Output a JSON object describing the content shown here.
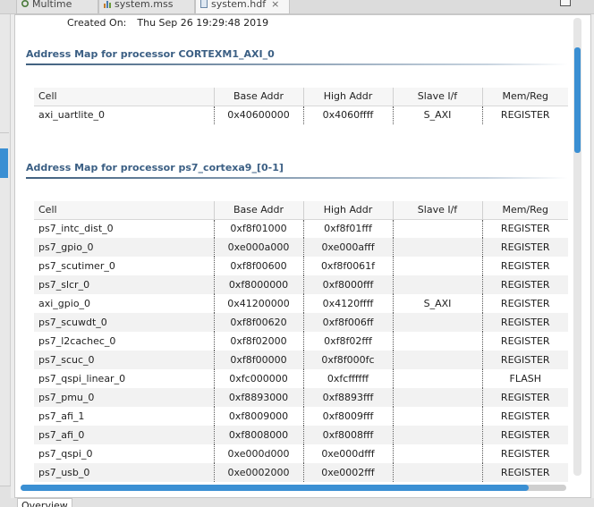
{
  "tabs": [
    {
      "label": "Multime",
      "icon": "gear-icon"
    },
    {
      "label": "system.mss",
      "icon": "chart-icon"
    },
    {
      "label": "system.hdf",
      "icon": "document-icon",
      "close": "×"
    }
  ],
  "created": {
    "label": "Created On:",
    "value": "Thu Sep 26 19:29:48 2019"
  },
  "columns": [
    "Cell",
    "Base Addr",
    "High Addr",
    "Slave I/f",
    "Mem/Reg"
  ],
  "sections": [
    {
      "title": "Address Map for processor CORTEXM1_AXI_0",
      "rows": [
        [
          "axi_uartlite_0",
          "0x40600000",
          "0x4060ffff",
          "S_AXI",
          "REGISTER"
        ]
      ]
    },
    {
      "title": "Address Map for processor ps7_cortexa9_[0-1]",
      "rows": [
        [
          "ps7_intc_dist_0",
          "0xf8f01000",
          "0xf8f01fff",
          "",
          "REGISTER"
        ],
        [
          "ps7_gpio_0",
          "0xe000a000",
          "0xe000afff",
          "",
          "REGISTER"
        ],
        [
          "ps7_scutimer_0",
          "0xf8f00600",
          "0xf8f0061f",
          "",
          "REGISTER"
        ],
        [
          "ps7_slcr_0",
          "0xf8000000",
          "0xf8000fff",
          "",
          "REGISTER"
        ],
        [
          "axi_gpio_0",
          "0x41200000",
          "0x4120ffff",
          "S_AXI",
          "REGISTER"
        ],
        [
          "ps7_scuwdt_0",
          "0xf8f00620",
          "0xf8f006ff",
          "",
          "REGISTER"
        ],
        [
          "ps7_l2cachec_0",
          "0xf8f02000",
          "0xf8f02fff",
          "",
          "REGISTER"
        ],
        [
          "ps7_scuc_0",
          "0xf8f00000",
          "0xf8f000fc",
          "",
          "REGISTER"
        ],
        [
          "ps7_qspi_linear_0",
          "0xfc000000",
          "0xfcffffff",
          "",
          "FLASH"
        ],
        [
          "ps7_pmu_0",
          "0xf8893000",
          "0xf8893fff",
          "",
          "REGISTER"
        ],
        [
          "ps7_afi_1",
          "0xf8009000",
          "0xf8009fff",
          "",
          "REGISTER"
        ],
        [
          "ps7_afi_0",
          "0xf8008000",
          "0xf8008fff",
          "",
          "REGISTER"
        ],
        [
          "ps7_qspi_0",
          "0xe000d000",
          "0xe000dfff",
          "",
          "REGISTER"
        ],
        [
          "ps7_usb_0",
          "0xe0002000",
          "0xe0002fff",
          "",
          "REGISTER"
        ]
      ]
    }
  ],
  "bottom_tab": {
    "label": "Overview"
  },
  "colors": {
    "accent": "#3a8fd3",
    "section_title": "#3b5f84"
  }
}
